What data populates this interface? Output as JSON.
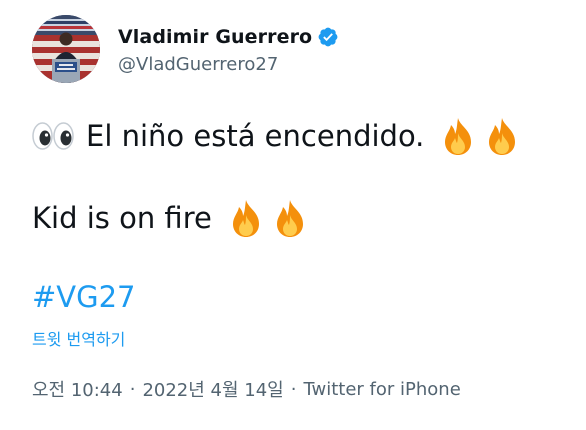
{
  "user": {
    "display_name": "Vladimir Guerrero",
    "handle": "@VladGuerrero27",
    "verified": true,
    "avatar_icon": "hall-of-fame-podium-photo"
  },
  "tweet": {
    "line1_text": "El niño está encendido.",
    "line2_text": "Kid is on fire",
    "line1_emojis": [
      "eyes",
      "fire",
      "fire"
    ],
    "line2_emojis": [
      "fire",
      "fire"
    ],
    "hashtag": "#VG27",
    "translate_label": "트윗 번역하기",
    "timestamp": "오전 10:44",
    "separator": "·",
    "date": "2022년 4월 14일",
    "source": "Twitter for iPhone"
  },
  "colors": {
    "text": "#0f1419",
    "secondary": "#536471",
    "link": "#1d9bf0",
    "verified": "#1d9bf0"
  }
}
